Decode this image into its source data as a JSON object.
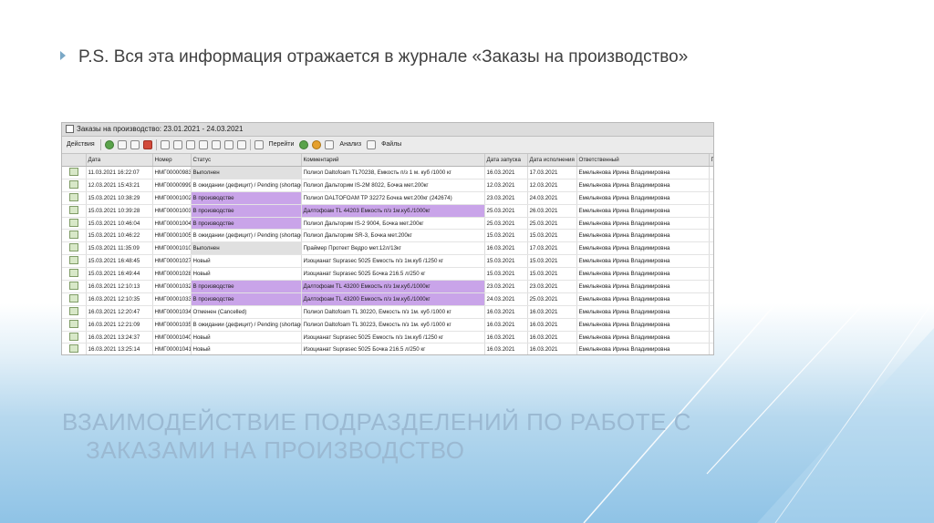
{
  "bullet": {
    "text": "P.S. Вся эта информация отражается в журнале «Заказы на производство»"
  },
  "heading": {
    "line1": "ВЗАИМОДЕЙСТВИЕ ПОДРАЗДЕЛЕНИЙ ПО РАБОТЕ С",
    "line2": "ЗАКАЗАМИ НА ПРОИЗВОДСТВО"
  },
  "window": {
    "title": "Заказы на производство: 23.01.2021 - 24.03.2021"
  },
  "toolbar": {
    "actions": "Действия",
    "goto": "Перейти",
    "analysis": "Анализ",
    "files": "Файлы"
  },
  "table": {
    "headers": {
      "date": "Дата",
      "number": "Номер",
      "status": "Статус",
      "comment": "Комментарий",
      "launch": "Дата запуска",
      "exec": "Дата исполнения",
      "resp": "Ответственный",
      "extra": "П"
    },
    "rows": [
      {
        "date": "11.03.2021 16:22:07",
        "number": "НМГ00000983",
        "status": "Выполнен",
        "comment": "Полиол Daltofoam TL70238, Емкость п/з 1 м. куб /1000 кг",
        "launch": "16.03.2021",
        "exec": "17.03.2021",
        "resp": "Емельянова Ирина Владимировна",
        "st": "done"
      },
      {
        "date": "12.03.2021 15:43:21",
        "number": "НМГ00000999",
        "status": "В ожидании (дефицит) / Pending (shortage)",
        "comment": "Полиол Дальторим IS-2M 8022, Бочка мет.200кг",
        "launch": "12.03.2021",
        "exec": "12.03.2021",
        "resp": "Емельянова Ирина Владимировна",
        "st": ""
      },
      {
        "date": "15.03.2021 10:38:29",
        "number": "НМГ00001002",
        "status": "В производстве",
        "comment": "Полиол DALTOFOAM TP 32272 Бочка мет.200кг (242674)",
        "launch": "23.03.2021",
        "exec": "24.03.2021",
        "resp": "Емельянова Ирина Владимировна",
        "st": "prod"
      },
      {
        "date": "15.03.2021 10:39:28",
        "number": "НМГ00001003",
        "status": "В производстве",
        "comment": "Далтофоам TL 44203 Емкость п/з 1м.куб./1000кг",
        "launch": "25.03.2021",
        "exec": "26.03.2021",
        "resp": "Емельянова Ирина Владимировна",
        "st": "prod"
      },
      {
        "date": "15.03.2021 10:46:04",
        "number": "НМГ00001004",
        "status": "В производстве",
        "comment": "Полиол Дальторим IS-2 9004, Бочка мет.200кг",
        "launch": "25.03.2021",
        "exec": "25.03.2021",
        "resp": "Емельянова Ирина Владимировна",
        "st": "prod"
      },
      {
        "date": "15.03.2021 10:46:22",
        "number": "НМГ00001005",
        "status": "В ожидании (дефицит) / Pending (shortage)",
        "comment": "Полиол Дальторим SR-3, Бочка мет.200кг",
        "launch": "15.03.2021",
        "exec": "15.03.2021",
        "resp": "Емельянова Ирина Владимировна",
        "st": ""
      },
      {
        "date": "15.03.2021 11:35:09",
        "number": "НМГ00001010",
        "status": "Выполнен",
        "comment": "Праймер Протект Ведро мет.12л/13кг",
        "launch": "16.03.2021",
        "exec": "17.03.2021",
        "resp": "Емельянова Ирина Владимировна",
        "st": "done"
      },
      {
        "date": "15.03.2021 16:48:45",
        "number": "НМГ00001027",
        "status": "Новый",
        "comment": "Изоцианат Suprasec 5025 Емкость п/з 1м.куб /1250 кг",
        "launch": "15.03.2021",
        "exec": "15.03.2021",
        "resp": "Емельянова Ирина Владимировна",
        "st": ""
      },
      {
        "date": "15.03.2021 16:49:44",
        "number": "НМГ00001028",
        "status": "Новый",
        "comment": "Изоцианат Suprasec 5025 Бочка 216.5 л/250 кг",
        "launch": "15.03.2021",
        "exec": "15.03.2021",
        "resp": "Емельянова Ирина Владимировна",
        "st": ""
      },
      {
        "date": "16.03.2021 12:10:13",
        "number": "НМГ00001032",
        "status": "В производстве",
        "comment": "Далтофоам TL 43200 Емкость п/з 1м.куб./1000кг",
        "launch": "23.03.2021",
        "exec": "23.03.2021",
        "resp": "Емельянова Ирина Владимировна",
        "st": "prod"
      },
      {
        "date": "16.03.2021 12:10:35",
        "number": "НМГ00001033",
        "status": "В производстве",
        "comment": "Далтофоам TL 43200 Емкость п/з 1м.куб./1000кг",
        "launch": "24.03.2021",
        "exec": "25.03.2021",
        "resp": "Емельянова Ирина Владимировна",
        "st": "prod"
      },
      {
        "date": "16.03.2021 12:20:47",
        "number": "НМГ00001034",
        "status": "Отменен (Cancelled)",
        "comment": "Полиол Daltofoam TL 30220, Емкость п/з 1м. куб /1000 кг",
        "launch": "16.03.2021",
        "exec": "16.03.2021",
        "resp": "Емельянова Ирина Владимировна",
        "st": ""
      },
      {
        "date": "16.03.2021 12:21:09",
        "number": "НМГ00001035",
        "status": "В ожидании (дефицит) / Pending (shortage)",
        "comment": "Полиол Daltofoam TL 30223, Емкость п/з 1м. куб /1000 кг",
        "launch": "16.03.2021",
        "exec": "16.03.2021",
        "resp": "Емельянова Ирина Владимировна",
        "st": ""
      },
      {
        "date": "16.03.2021 13:24:37",
        "number": "НМГ00001040",
        "status": "Новый",
        "comment": "Изоцианат Suprasec 5025 Емкость п/з 1м.куб /1250 кг",
        "launch": "16.03.2021",
        "exec": "16.03.2021",
        "resp": "Емельянова Ирина Владимировна",
        "st": ""
      },
      {
        "date": "16.03.2021 13:25:14",
        "number": "НМГ00001041",
        "status": "Новый",
        "comment": "Изоцианат Suprasec 5025 Бочка 216.5 л/250 кг",
        "launch": "16.03.2021",
        "exec": "16.03.2021",
        "resp": "Емельянова Ирина Владимировна",
        "st": ""
      }
    ]
  }
}
